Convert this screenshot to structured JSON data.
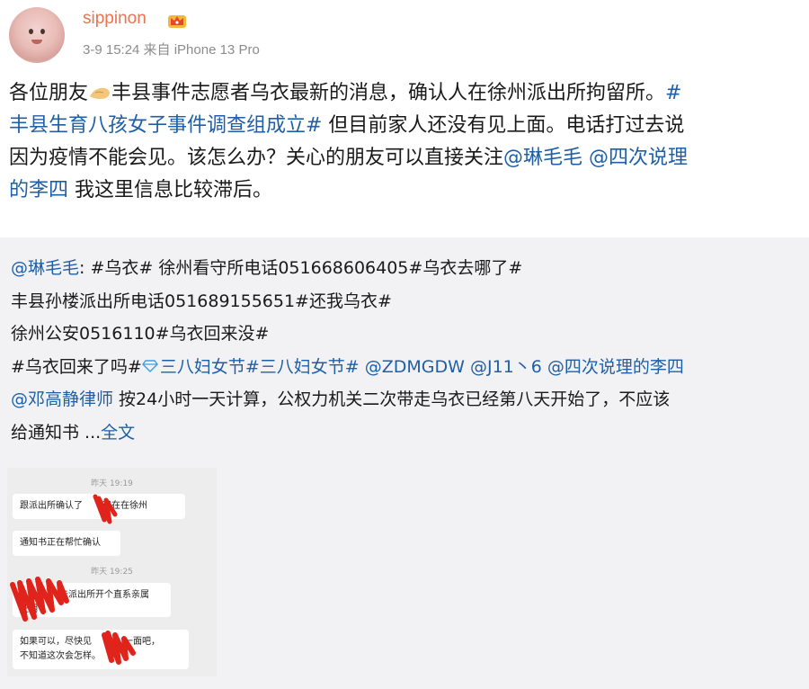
{
  "user": {
    "name": "sippinon",
    "badge_icon": "crown-icon",
    "avatar": "avatar-pig-icon"
  },
  "meta": "3-9 15:24 来自 iPhone 13 Pro",
  "post": {
    "l1a": "各位朋友",
    "l1b": "丰县事件志愿者乌衣最新的消息，确认人在徐州派出所拘留所。",
    "l1c": "#",
    "l2a": "丰县生育八孩女子事件调查组成立#",
    "l2b": " 但目前家人还没有见上面。电话打过去说",
    "l3a": "因为疫情不能会见。该怎么办？关心的朋友可以直接关注",
    "l3b": "@琳毛毛",
    "l3c": " @四次说理",
    "l4a": "的李四",
    "l4b": " 我这里信息比较滞后。"
  },
  "repost": {
    "r1a": "@琳毛毛",
    "r1b": ": #乌衣# 徐州看守所电话051668606405#乌衣去哪了#",
    "r2": "丰县孙楼派出所电话051689155651#还我乌衣#",
    "r3": "徐州公安0516110#乌衣回来没#",
    "r4a": "#乌衣回来了吗#",
    "r4b": "三八妇女节",
    "r4c": "#三八妇女节#",
    "r4d": " @ZDMGDW",
    "r4e": " @J11丶6",
    "r4f": " @四次说理的李四",
    "r5a": "@邓高静律师",
    "r5b": " 按24小时一天计算，公权力机关二次带走乌衣已经第八天开始了，不应该",
    "r6a": "给通知书 ...",
    "r6b": "全文"
  },
  "chat_image": {
    "time1": "昨天 19:19",
    "msg1": "跟派出所确认了",
    "msg1b": "现在在徐州",
    "msg2": "通知书正在帮忙确认",
    "time2": "昨天 19:25",
    "msg3": "去派出所开个直系亲属",
    "msg3b": "证明",
    "msg4": "如果可以，尽快见",
    "msg4b": "一面吧，",
    "msg4c": "不知道这次会怎样。"
  },
  "colors": {
    "username": "#eb7350",
    "link": "#1f5fa6",
    "meta": "#8c8c8c",
    "repost_bg": "#f2f2f5",
    "redaction": "#e0241b"
  }
}
